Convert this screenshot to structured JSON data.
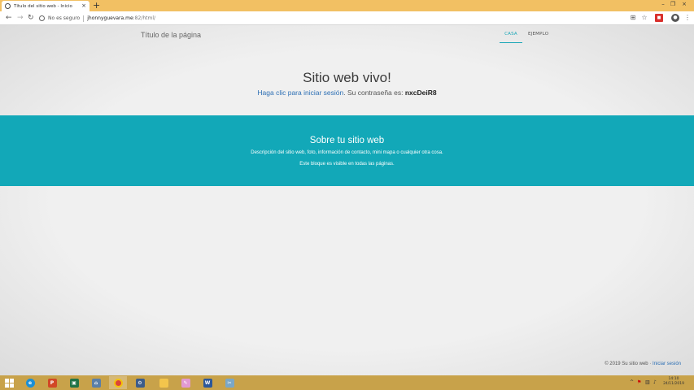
{
  "browser": {
    "tab_title": "Título del sitio web - Inicio",
    "tab_close": "×",
    "new_tab": "+",
    "security_label": "No es seguro",
    "url_host": "jhonnyguevara.me",
    "url_path": ":82/html/",
    "window_controls": [
      "–",
      "❐",
      "×"
    ]
  },
  "site": {
    "title": "Título de la página",
    "nav": [
      {
        "label": "CASA",
        "active": true
      },
      {
        "label": "EJEMPLO",
        "active": false
      }
    ],
    "hero": {
      "heading": "Sitio web vivo!",
      "login_link": "Haga clic para iniciar sesión",
      "password_text": ". Su contraseña es: ",
      "password": "nxcDeiR8"
    },
    "about": {
      "title": "Sobre tu sitio web",
      "line1": "Descripción del sitio web, foto, información de contacto, mini mapa o cualquier otra cosa.",
      "line2": "Este bloque es visible en todas las páginas."
    },
    "footer": {
      "text": "© 2019 Su sitio web · ",
      "login_link": "Iniciar sesión"
    }
  },
  "taskbar": {
    "time": "14:10",
    "date": "24/11/2019"
  },
  "colors": {
    "accent": "#12a8b8",
    "link": "#2d6fb4",
    "chrome_frame": "#f2c063",
    "taskbar": "#c8a24a"
  }
}
